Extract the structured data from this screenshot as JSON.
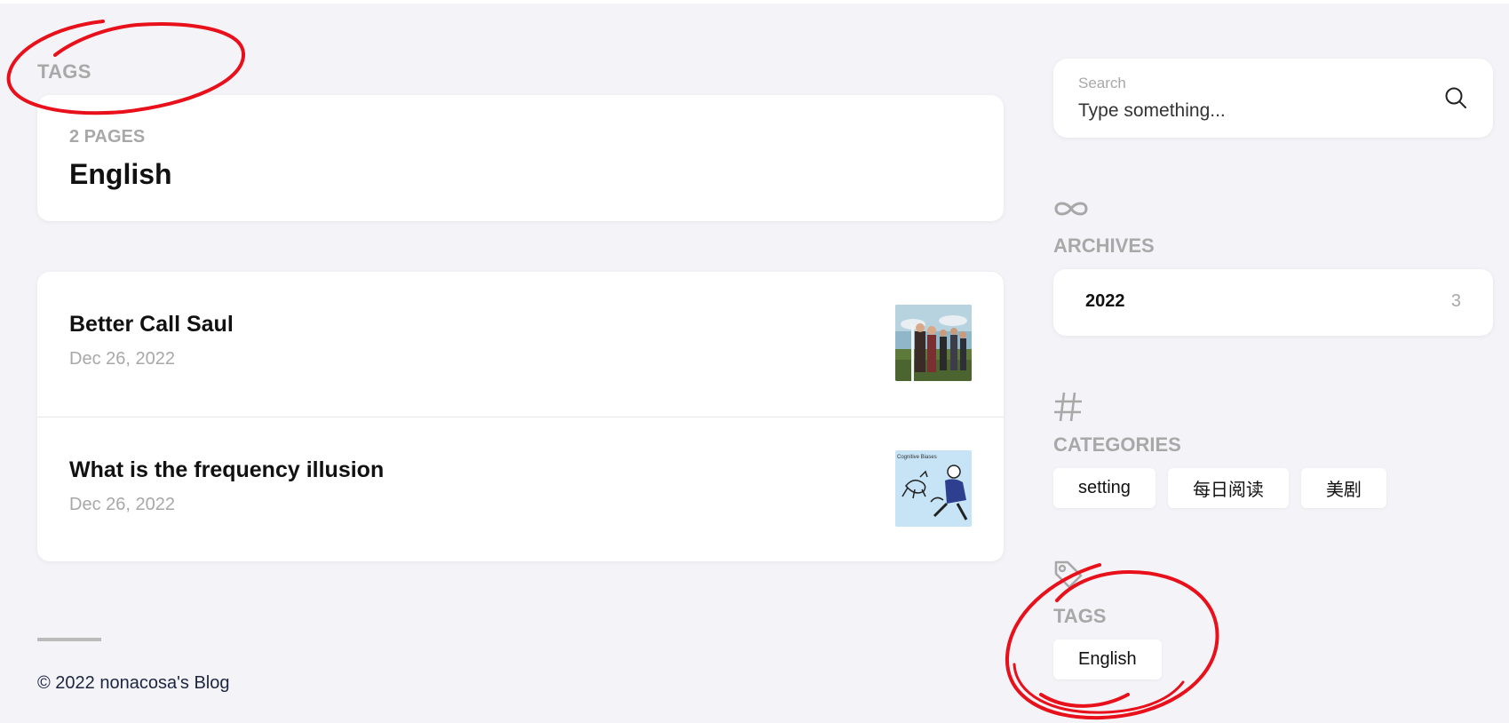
{
  "page": {
    "heading": "TAGS"
  },
  "tag_card": {
    "count_label": "2 PAGES",
    "title": "English"
  },
  "posts": [
    {
      "title": "Better Call Saul",
      "date": "Dec 26, 2022",
      "thumbnail": "tv-show-cast-photo"
    },
    {
      "title": "What is the frequency illusion",
      "date": "Dec 26, 2022",
      "thumbnail": "cognitive-biases-illustration",
      "thumbnail_caption": "Cognitive Biases"
    }
  ],
  "footer": {
    "copyright": "© 2022 nonacosa's Blog"
  },
  "sidebar": {
    "search": {
      "label": "Search",
      "placeholder": "Type something...",
      "icon": "search-icon"
    },
    "archives": {
      "icon": "infinity-icon",
      "title": "ARCHIVES",
      "items": [
        {
          "year": "2022",
          "count": "3"
        }
      ]
    },
    "categories": {
      "icon": "hash-icon",
      "title": "CATEGORIES",
      "items": [
        "setting",
        "每日阅读",
        "美剧"
      ]
    },
    "tags": {
      "icon": "tag-icon",
      "title": "TAGS",
      "items": [
        "English"
      ]
    }
  },
  "colors": {
    "background": "#f4f4f8",
    "card": "#ffffff",
    "muted_text": "#a8a8a8",
    "annotation_red": "#e8101a"
  }
}
